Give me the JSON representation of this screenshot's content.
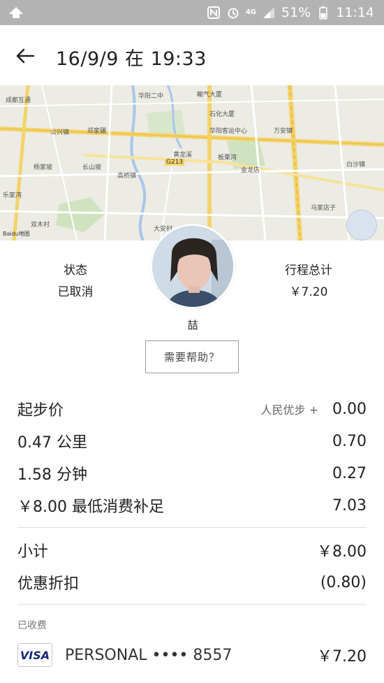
{
  "status_bar": {
    "battery": "51%",
    "time": "11:14",
    "network": "4G"
  },
  "header": {
    "title": "16/9/9 在 19:33"
  },
  "map_labels": {
    "nw": "成都互通",
    "n1": "华阳二中",
    "n2": "輸气大厦",
    "n3": "石化大厦",
    "n4": "华阳客运中心",
    "n5": "公兴镇",
    "n6": "万安镇",
    "n7": "邓家碾",
    "n8": "长山坡",
    "n9": "白沙镇",
    "n10": "杨家坡",
    "n11": "金龙店",
    "n12": "板栗湾",
    "n13": "马家店子",
    "n14": "乐家湾",
    "n15": "双木村",
    "n16": "高桥镇",
    "n17": "大安村",
    "n18": "黄龙溪",
    "road": "G213",
    "watermark": "Baidu地图"
  },
  "trip": {
    "status_label": "状态",
    "status_value": "已取消",
    "total_label": "行程总计",
    "total_value": "￥7.20",
    "driver_name": "喆",
    "help_button": "需要帮助？"
  },
  "fare": {
    "rows": [
      {
        "label": "起步价",
        "promo": "人民优步 +",
        "amount": "0.00"
      },
      {
        "label": "0.47 公里",
        "promo": "",
        "amount": "0.70"
      },
      {
        "label": "1.58 分钟",
        "promo": "",
        "amount": "0.27"
      },
      {
        "label": "￥8.00 最低消费补足",
        "promo": "",
        "amount": "7.03"
      }
    ],
    "subtotal_label": "小计",
    "subtotal_value": "￥8.00",
    "discount_label": "优惠折扣",
    "discount_value": "(0.80)",
    "paid_label": "已收费",
    "payment": {
      "card_brand": "VISA",
      "label": "PERSONAL •••• 8557",
      "amount": "￥7.20"
    }
  }
}
